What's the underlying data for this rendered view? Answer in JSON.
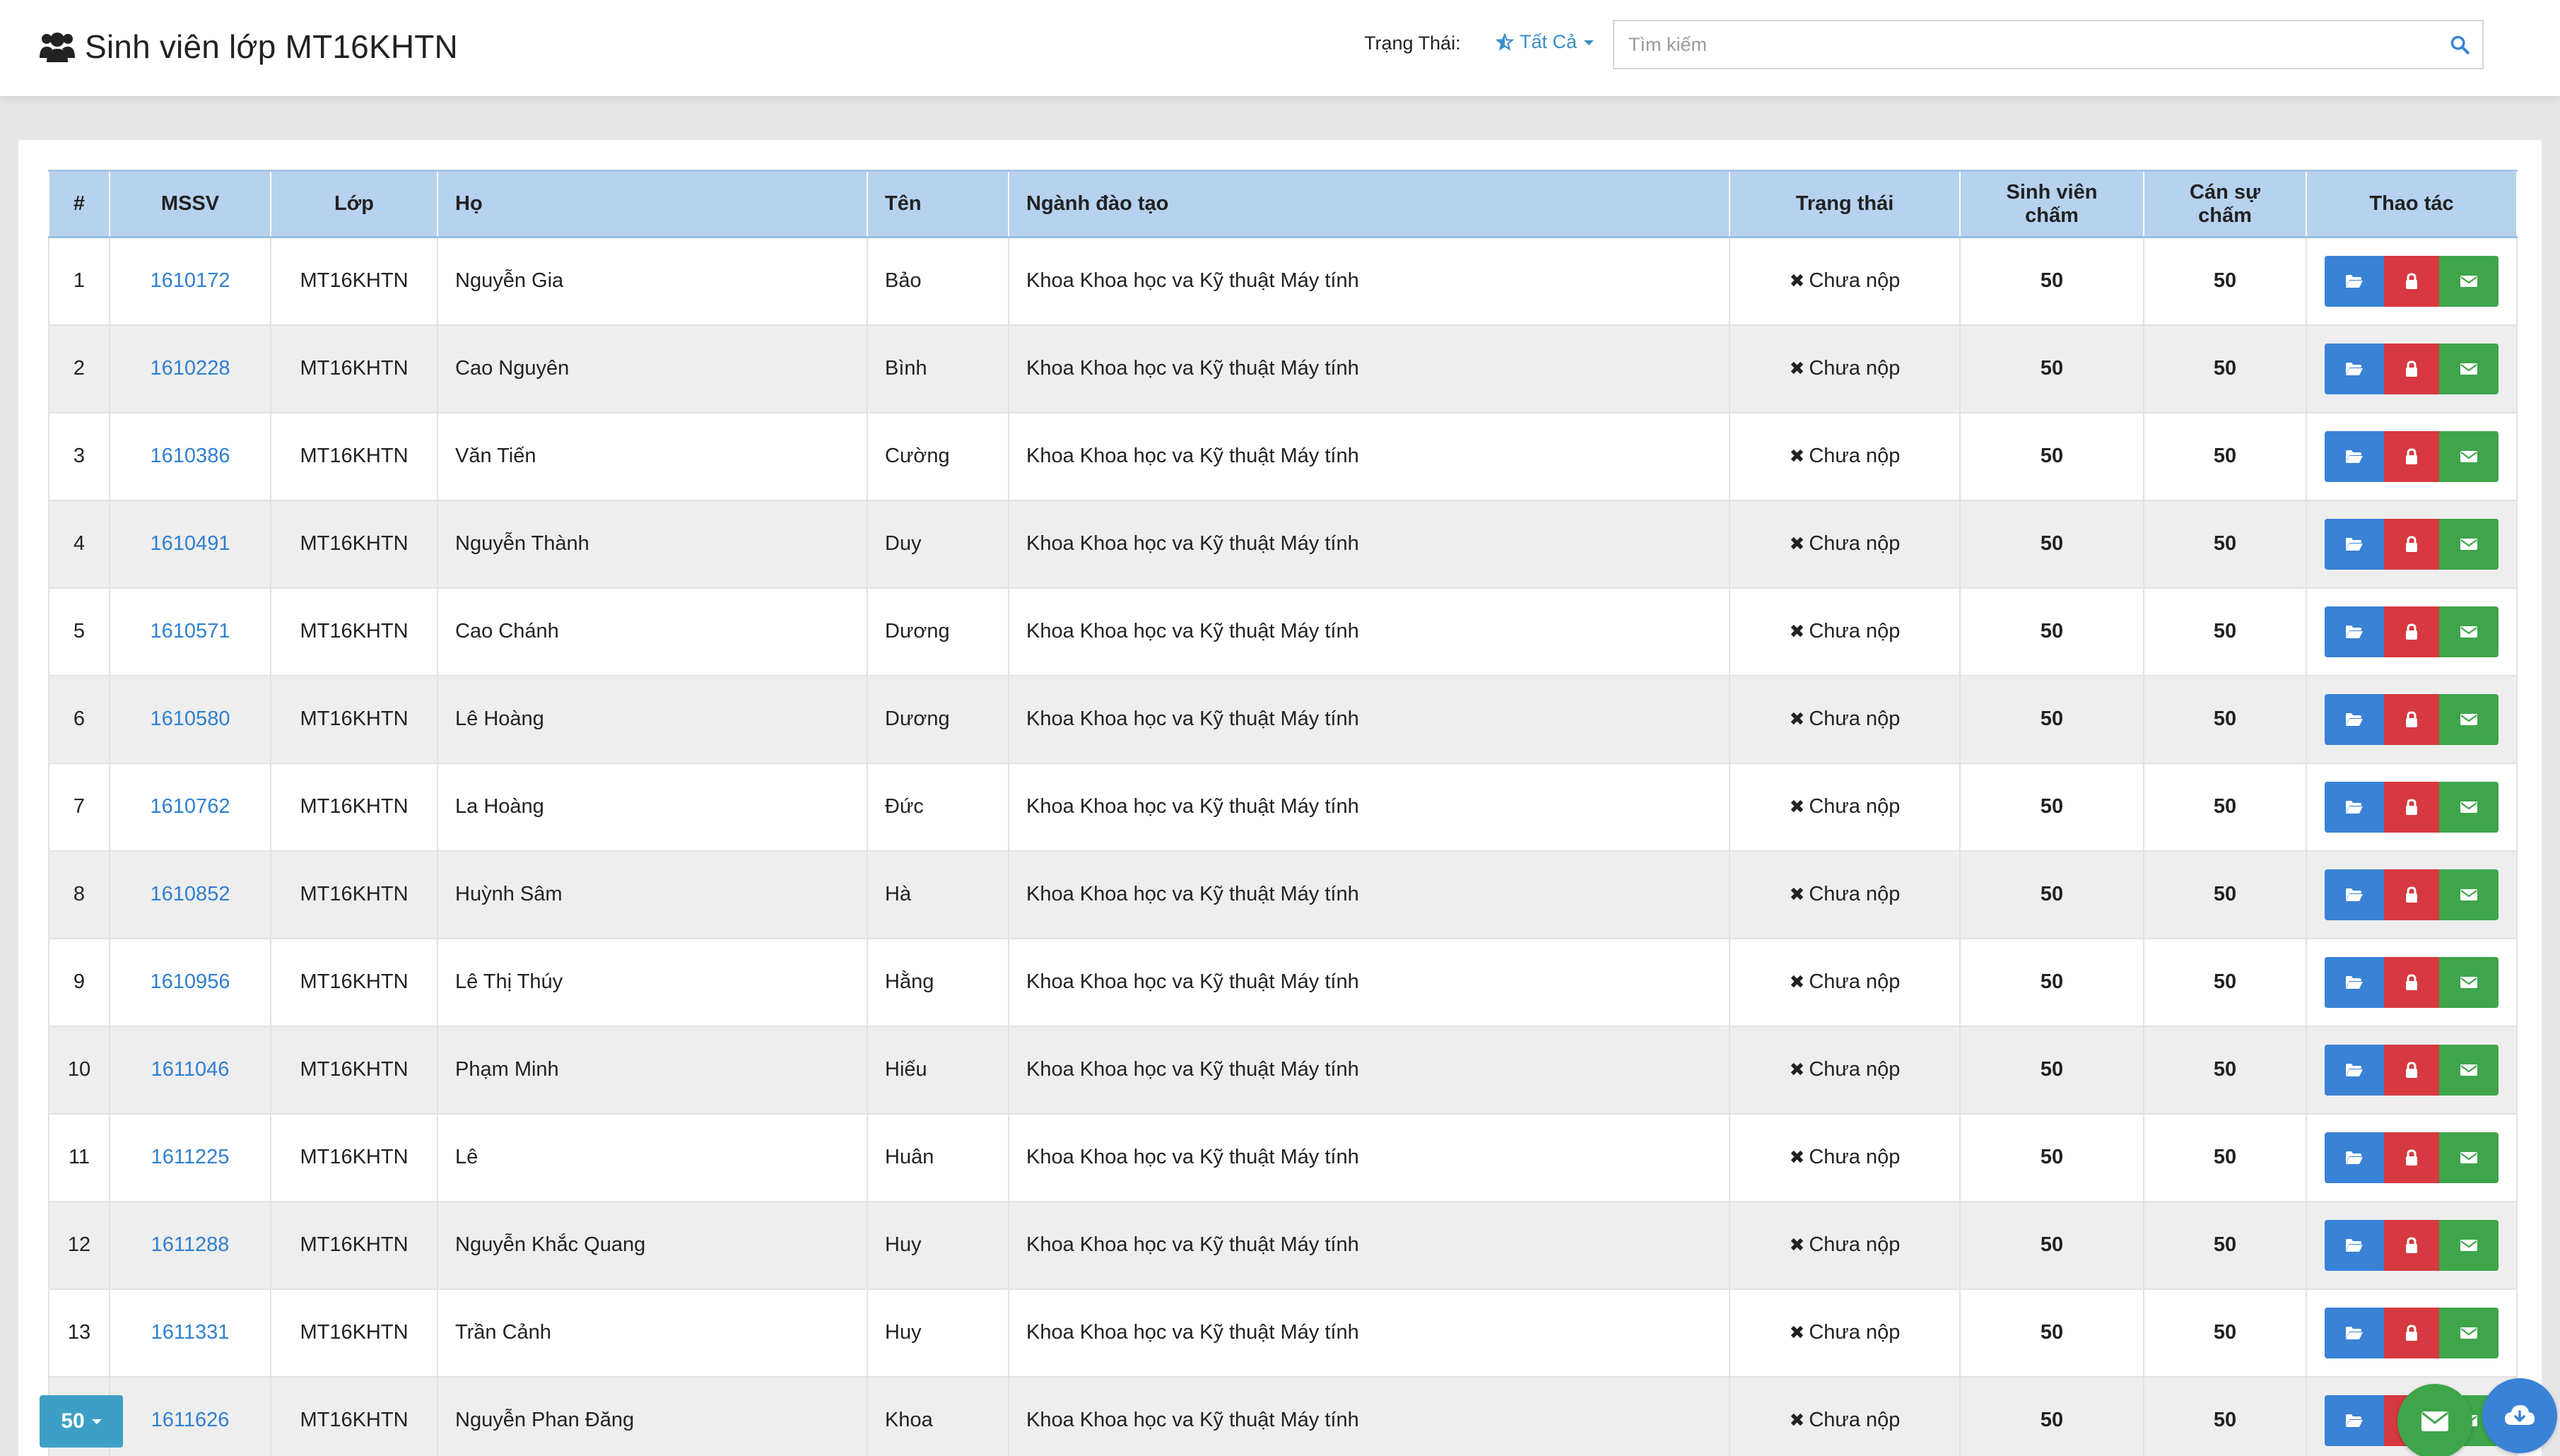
{
  "header": {
    "title": "Sinh viên lớp MT16KHTN",
    "status_label": "Trạng Thái:",
    "status_value": "Tất Cả",
    "search_placeholder": "Tìm kiếm"
  },
  "table": {
    "columns": [
      "#",
      "MSSV",
      "Lớp",
      "Họ",
      "Tên",
      "Ngành đào tạo",
      "Trạng thái",
      "Sinh viên chấm",
      "Cán sự chấm",
      "Thao tác"
    ],
    "rows": [
      {
        "no": "1",
        "mssv": "1610172",
        "lop": "MT16KHTN",
        "ho": "Nguyễn Gia",
        "ten": "Bảo",
        "nganh": "Khoa Khoa học va Kỹ thuật Máy tính",
        "status": "Chưa nộp",
        "sv": "50",
        "cs": "50"
      },
      {
        "no": "2",
        "mssv": "1610228",
        "lop": "MT16KHTN",
        "ho": "Cao Nguyên",
        "ten": "Bình",
        "nganh": "Khoa Khoa học va Kỹ thuật Máy tính",
        "status": "Chưa nộp",
        "sv": "50",
        "cs": "50"
      },
      {
        "no": "3",
        "mssv": "1610386",
        "lop": "MT16KHTN",
        "ho": "Văn Tiến",
        "ten": "Cường",
        "nganh": "Khoa Khoa học va Kỹ thuật Máy tính",
        "status": "Chưa nộp",
        "sv": "50",
        "cs": "50"
      },
      {
        "no": "4",
        "mssv": "1610491",
        "lop": "MT16KHTN",
        "ho": "Nguyễn Thành",
        "ten": "Duy",
        "nganh": "Khoa Khoa học va Kỹ thuật Máy tính",
        "status": "Chưa nộp",
        "sv": "50",
        "cs": "50"
      },
      {
        "no": "5",
        "mssv": "1610571",
        "lop": "MT16KHTN",
        "ho": "Cao Chánh",
        "ten": "Dương",
        "nganh": "Khoa Khoa học va Kỹ thuật Máy tính",
        "status": "Chưa nộp",
        "sv": "50",
        "cs": "50"
      },
      {
        "no": "6",
        "mssv": "1610580",
        "lop": "MT16KHTN",
        "ho": "Lê Hoàng",
        "ten": "Dương",
        "nganh": "Khoa Khoa học va Kỹ thuật Máy tính",
        "status": "Chưa nộp",
        "sv": "50",
        "cs": "50"
      },
      {
        "no": "7",
        "mssv": "1610762",
        "lop": "MT16KHTN",
        "ho": "La Hoàng",
        "ten": "Đức",
        "nganh": "Khoa Khoa học va Kỹ thuật Máy tính",
        "status": "Chưa nộp",
        "sv": "50",
        "cs": "50"
      },
      {
        "no": "8",
        "mssv": "1610852",
        "lop": "MT16KHTN",
        "ho": "Huỳnh Sâm",
        "ten": "Hà",
        "nganh": "Khoa Khoa học va Kỹ thuật Máy tính",
        "status": "Chưa nộp",
        "sv": "50",
        "cs": "50"
      },
      {
        "no": "9",
        "mssv": "1610956",
        "lop": "MT16KHTN",
        "ho": "Lê Thị Thúy",
        "ten": "Hằng",
        "nganh": "Khoa Khoa học va Kỹ thuật Máy tính",
        "status": "Chưa nộp",
        "sv": "50",
        "cs": "50"
      },
      {
        "no": "10",
        "mssv": "1611046",
        "lop": "MT16KHTN",
        "ho": "Phạm Minh",
        "ten": "Hiếu",
        "nganh": "Khoa Khoa học va Kỹ thuật Máy tính",
        "status": "Chưa nộp",
        "sv": "50",
        "cs": "50"
      },
      {
        "no": "11",
        "mssv": "1611225",
        "lop": "MT16KHTN",
        "ho": "Lê",
        "ten": "Huân",
        "nganh": "Khoa Khoa học va Kỹ thuật Máy tính",
        "status": "Chưa nộp",
        "sv": "50",
        "cs": "50"
      },
      {
        "no": "12",
        "mssv": "1611288",
        "lop": "MT16KHTN",
        "ho": "Nguyễn Khắc Quang",
        "ten": "Huy",
        "nganh": "Khoa Khoa học va Kỹ thuật Máy tính",
        "status": "Chưa nộp",
        "sv": "50",
        "cs": "50"
      },
      {
        "no": "13",
        "mssv": "1611331",
        "lop": "MT16KHTN",
        "ho": "Trần Cảnh",
        "ten": "Huy",
        "nganh": "Khoa Khoa học va Kỹ thuật Máy tính",
        "status": "Chưa nộp",
        "sv": "50",
        "cs": "50"
      },
      {
        "no": "14",
        "mssv": "1611626",
        "lop": "MT16KHTN",
        "ho": "Nguyễn Phan Đăng",
        "ten": "Khoa",
        "nganh": "Khoa Khoa học va Kỹ thuật Máy tính",
        "status": "Chưa nộp",
        "sv": "50",
        "cs": "50"
      }
    ]
  },
  "footer": {
    "page_size": "50"
  },
  "icons": {
    "header": "users-icon",
    "status": "star-icon",
    "search": "search-icon",
    "row_actions": [
      "folder-open-icon",
      "lock-icon",
      "envelope-icon"
    ],
    "fabs": [
      "envelope-icon",
      "cloud-download-icon"
    ]
  },
  "colors": {
    "header_row": "#b6d2ee",
    "link": "#2f7fd0",
    "status_red": "#d63a3a",
    "score_green": "#3aa44a",
    "btn_blue": "#3a82d6",
    "btn_red": "#d6393f",
    "btn_green": "#3ea54b",
    "page_size_button": "#3e9fc6"
  }
}
